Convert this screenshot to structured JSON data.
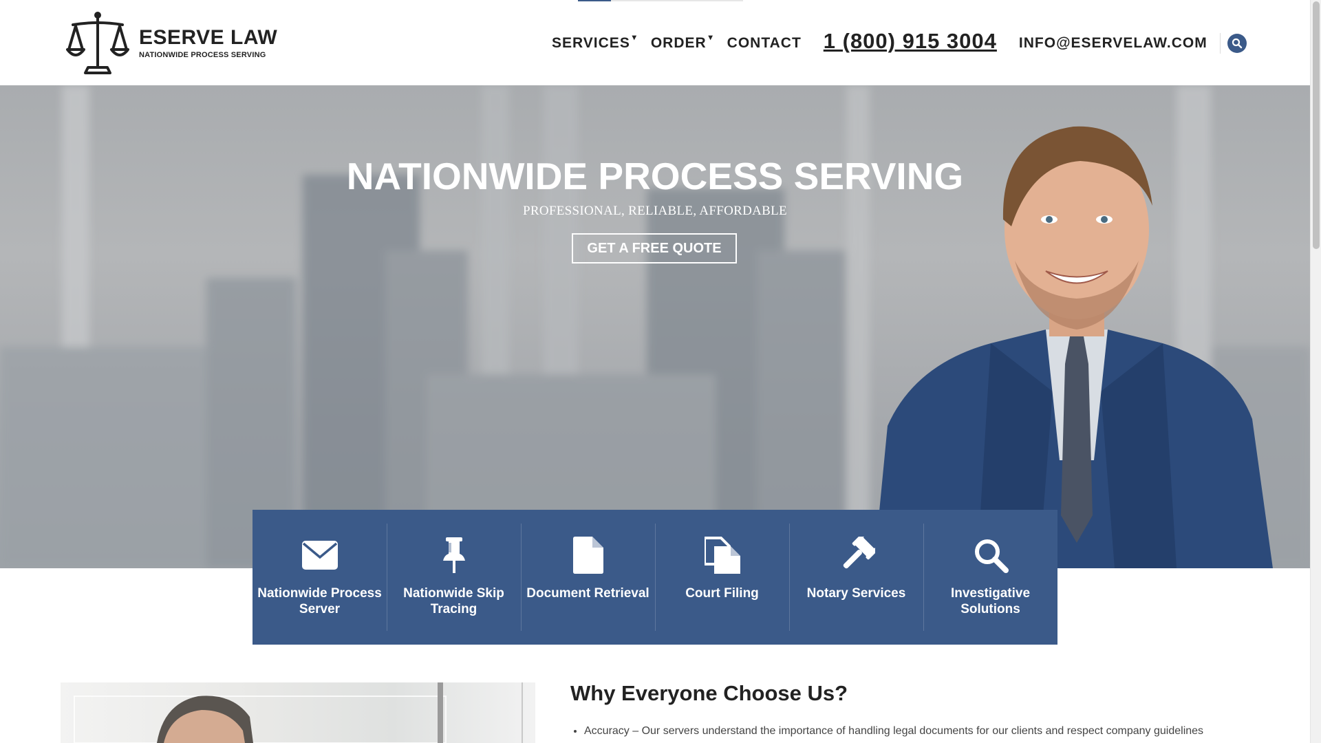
{
  "brand": {
    "name": "ESERVE LAW",
    "tagline": "NATIONWIDE PROCESS SERVING"
  },
  "nav": {
    "services": "SERVICES",
    "order": "ORDER",
    "contact": "CONTACT",
    "phone": "1 (800) 915 3004",
    "email": "INFO@ESERVELAW.COM",
    "search_icon": "search-icon"
  },
  "hero": {
    "title": "NATIONWIDE PROCESS SERVING",
    "subtitle": "PROFESSIONAL, RELIABLE, AFFORDABLE",
    "cta": "GET A FREE QUOTE"
  },
  "services": [
    {
      "label": "Nationwide Process Server",
      "icon": "envelope-icon"
    },
    {
      "label": "Nationwide Skip Tracing",
      "icon": "pushpin-icon"
    },
    {
      "label": "Document Retrieval",
      "icon": "document-icon"
    },
    {
      "label": "Court Filing",
      "icon": "files-icon"
    },
    {
      "label": "Notary Services",
      "icon": "gavel-icon"
    },
    {
      "label": "Investigative Solutions",
      "icon": "magnifier-icon"
    }
  ],
  "why": {
    "title": "Why Everyone Choose Us?",
    "items": [
      "Accuracy – Our servers understand the importance of handling legal documents for our clients and respect company guidelines"
    ]
  },
  "colors": {
    "accent": "#3b5a89",
    "text": "#222222",
    "hero_text": "#ffffff"
  }
}
